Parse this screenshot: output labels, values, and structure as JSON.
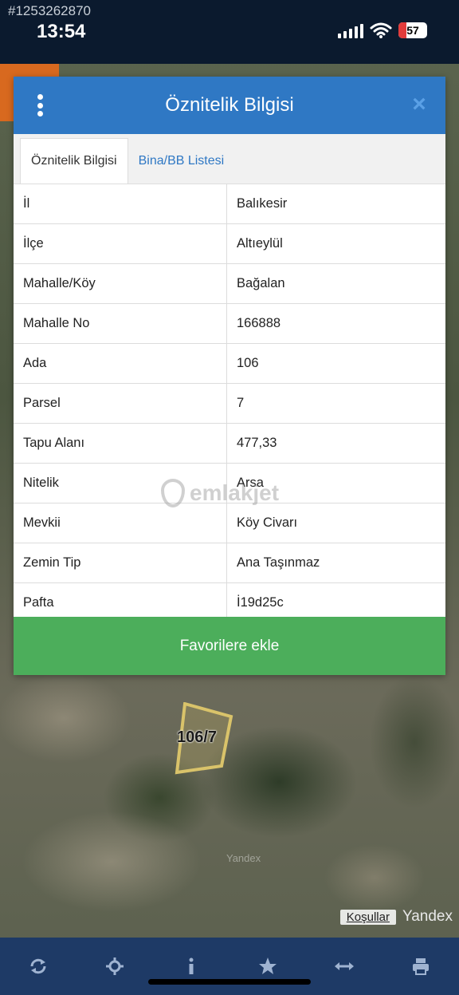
{
  "status_bar": {
    "listing_id": "#1253262870",
    "time": "13:54",
    "battery": "57"
  },
  "dialog": {
    "title": "Öznitelik Bilgisi",
    "tabs": [
      {
        "label": "Öznitelik Bilgisi",
        "active": true
      },
      {
        "label": "Bina/BB Listesi",
        "active": false
      }
    ],
    "rows": [
      {
        "key": "İl",
        "value": "Balıkesir"
      },
      {
        "key": "İlçe",
        "value": "Altıeylül"
      },
      {
        "key": "Mahalle/Köy",
        "value": "Bağalan"
      },
      {
        "key": "Mahalle No",
        "value": "166888"
      },
      {
        "key": "Ada",
        "value": "106"
      },
      {
        "key": "Parsel",
        "value": "7"
      },
      {
        "key": "Tapu Alanı",
        "value": "477,33"
      },
      {
        "key": "Nitelik",
        "value": "Arsa"
      },
      {
        "key": "Mevkii",
        "value": "Köy Civarı"
      },
      {
        "key": "Zemin Tip",
        "value": "Ana Taşınmaz"
      },
      {
        "key": "Pafta",
        "value": "İ19d25c"
      }
    ],
    "favorite_button": "Favorilere ekle"
  },
  "watermark": "emlakjet",
  "map": {
    "parcel_label": "106/7",
    "center_brand": "Yandex",
    "terms_link": "Koşullar",
    "brand": "Yandex"
  },
  "toolbar": {
    "icons": [
      "refresh-icon",
      "locate-icon",
      "info-icon",
      "star-icon",
      "measure-icon",
      "print-icon"
    ]
  },
  "colors": {
    "header_blue": "#2f78c4",
    "button_green": "#4cae5b",
    "toolbar_navy": "#1e3a66",
    "accent_orange": "#d8691f"
  }
}
